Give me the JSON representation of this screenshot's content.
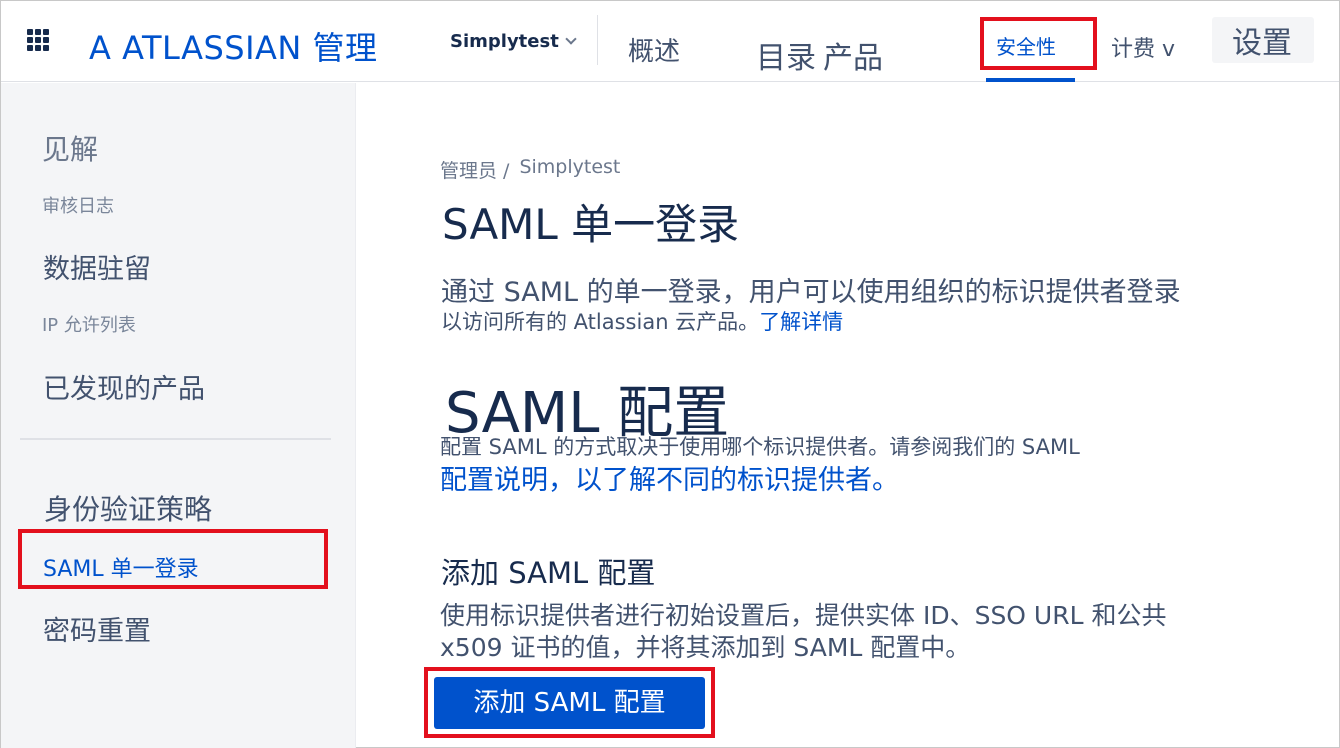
{
  "topbar": {
    "brand": "A ATLASSIAN 管理",
    "org_name": "Simplytest",
    "nav": {
      "overview": "概述",
      "directory": "目录",
      "products": "产品",
      "security": "安全性",
      "billing": "计费 v",
      "settings": "设置"
    },
    "active_tab": "security"
  },
  "sidebar": {
    "insights_heading": "见解",
    "audit_log": "审核日志",
    "data_residency": "数据驻留",
    "ip_allowlist": "IP 允许列表",
    "discovered_products": "已发现的产品",
    "auth_policies": "身份验证策略",
    "saml_sso": "SAML 单一登录",
    "password_reset": "密码重置"
  },
  "main": {
    "breadcrumb": [
      "管理员 /",
      "Simplytest"
    ],
    "title": "SAML 单一登录",
    "intro_line1": "通过 SAML 的单一登录，用户可以使用组织的标识提供者登录",
    "intro_line2": "以访问所有的 Atlassian 云产品。",
    "learn_more": "了解详情",
    "config_title": "SAML 配置",
    "config_line1": "配置 SAML 的方式取决于使用哪个标识提供者。请参阅我们的 SAML",
    "config_line2": "配置说明，以了解不同的标识提供者。",
    "add_title": "添加 SAML 配置",
    "add_desc_line1": "使用标识提供者进行初始设置后，提供实体 ID、SSO URL 和公共",
    "add_desc_line2": "x509 证书的值，并将其添加到 SAML 配置中。",
    "add_button": "添加 SAML 配置"
  },
  "colors": {
    "brand_blue": "#0052cc",
    "highlight_red": "#e3101d",
    "sidebar_bg": "#f4f5f7",
    "text_dark": "#172b4d",
    "text_body": "#42526e"
  },
  "icons": {
    "app_switcher": "grid-icon",
    "org_dropdown": "chevron-down-icon"
  }
}
